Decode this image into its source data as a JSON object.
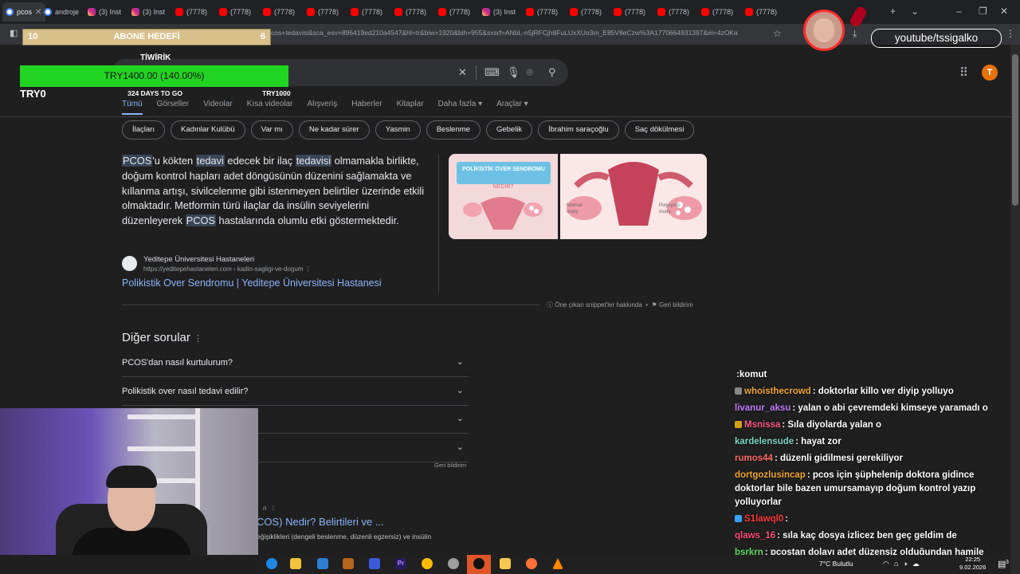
{
  "browser": {
    "tabs": [
      {
        "label": "pcos",
        "icon": "google-icon",
        "active": true
      },
      {
        "label": "androje",
        "icon": "google-icon"
      },
      {
        "label": "(3) Inst",
        "icon": "instagram-icon"
      },
      {
        "label": "(3) Inst",
        "icon": "instagram-icon"
      },
      {
        "label": "(7778)",
        "icon": "youtube-icon"
      },
      {
        "label": "(7778)",
        "icon": "youtube-icon"
      },
      {
        "label": "(7778)",
        "icon": "youtube-icon"
      },
      {
        "label": "(7778)",
        "icon": "youtube-icon"
      },
      {
        "label": "(7778)",
        "icon": "youtube-icon"
      },
      {
        "label": "(7778)",
        "icon": "youtube-icon"
      },
      {
        "label": "(7778)",
        "icon": "youtube-icon"
      },
      {
        "label": "(3) Inst",
        "icon": "instagram-icon"
      },
      {
        "label": "(7778)",
        "icon": "youtube-icon"
      },
      {
        "label": "(7778)",
        "icon": "youtube-icon"
      },
      {
        "label": "(7778)",
        "icon": "youtube-icon"
      },
      {
        "label": "(7778)",
        "icon": "youtube-icon"
      },
      {
        "label": "(7778)",
        "icon": "youtube-icon"
      },
      {
        "label": "(7778)",
        "icon": "youtube-icon"
      }
    ],
    "url": "cos+tedavisi&sca_esv=896419ed210a4547&hl=tr&biw=1920&bih=955&sxsrf=ANbL-n5jRFCjh8FuLUxXUo3m_E85V8eCzw%3A1770664931397&ei=4zOKa"
  },
  "search": {
    "nav_tabs": [
      "Tümü",
      "Görseller",
      "Videolar",
      "Kısa videolar",
      "Alışveriş",
      "Haberler",
      "Kitaplar",
      "Daha fazla ▾",
      "Araçlar ▾"
    ],
    "chips": [
      "İlaçları",
      "Kadınlar Kulübü",
      "Var mı",
      "Ne kadar sürer",
      "Yasmin",
      "Beslenme",
      "Gebelik",
      "İbrahim saraçoğlu",
      "Saç dökülmesi"
    ],
    "avatar_letter": "T"
  },
  "snippet": {
    "p1_hl": "PCOS",
    "p1": "'u kökten ",
    "p2_hl": "tedavi",
    "p2": " edecek bir ilaç ",
    "p3_hl": "tedavisi",
    "p3": " olmamakla birlikte, doğum kontrol hapları adet döngüsünün düzenini sağlamakta ve kıllanma artışı, sivilcelenme gibi istenmeyen belirtiler üzerinde etkili olmaktadır. Metformin türü ilaçlar da insülin seviyelerini düzenleyerek ",
    "p4_hl": "PCOS",
    "p4": " hastalarında olumlu etki göstermektedir.",
    "source_name": "Yeditepe Üniversitesi Hastaneleri",
    "source_url": "https://yeditepehastaneleri.com › kadin-sagligi-ve-dogum",
    "link": "Polikistik Over Sendromu | Yeditepe Üniversitesi Hastanesi",
    "about": "Öne çıkan snippet'ler hakkında",
    "feedback": "Geri bildirim",
    "image1_title": "POLİKİSTİK OVER SENDROMU",
    "image1_sub": "NEDİR?",
    "image2_l1": "Normal",
    "image2_l2": "ovary",
    "image2_r1": "Polycystic",
    "image2_r2": "ovary"
  },
  "paa": {
    "title": "Diğer sorular",
    "questions": [
      "PCOS'dan nasıl kurtulurum?",
      "Polikistik over nasıl tedavi edilir?",
      "",
      ""
    ],
    "feedback": "Geri bildirim"
  },
  "result2": {
    "title": "COS) Nedir? Belirtileri ve ...",
    "desc": "eğişiklikleri (dengeli beslenme, düzenli egzersiz) ve insülin",
    "crumb": "n"
  },
  "overlay": {
    "goal1_left": "10",
    "goal1_label": "ABONE HEDEFİ",
    "goal1_right": "6",
    "goal1_progress": 1.0,
    "donation_title": "TİWİRİK",
    "goal2_label": "TRY1400.00 (140.00%)",
    "goal2_progress": 1.0,
    "days": "324 DAYS TO GO",
    "target": "TRY1000",
    "start": "TRY0",
    "yt_handle": "youtube/tssigalko"
  },
  "chat": [
    {
      "user": "",
      "text": ":komut",
      "color": "#ffffff"
    },
    {
      "user": "whoisthecrowd",
      "text": ": doktorlar killo ver diyip yolluyo",
      "color": "#f0a830",
      "badge": "#888888"
    },
    {
      "user": "livanur_aksu",
      "text": ": yalan o abi çevremdeki kimseye yaramadı o",
      "color": "#c77dff"
    },
    {
      "user": "Msnissa",
      "text": ": Sıla diyolarda yalan o",
      "color": "#ff5c8a",
      "badge": "#d4a017"
    },
    {
      "user": "kardelensude",
      "text": ": hayat zor",
      "color": "#7fd6c2"
    },
    {
      "user": "rumos44",
      "text": ": düzenli gidilmesi gerekiliyor",
      "color": "#ff6b6b"
    },
    {
      "user": "dortgozlusincap",
      "text": ": pcos için şüphelenip doktora gidince doktorlar bile bazen umursamayıp doğum kontrol yazıp yolluyorlar",
      "color": "#f0a830"
    },
    {
      "user": "S1lawql0",
      "text": ":",
      "color": "#ff3b3b",
      "badge": "#3aa0ff"
    },
    {
      "user": "qlaws_16",
      "text": ": sıla kaç dosya izlicez ben geç geldim de",
      "color": "#ff4f7b"
    },
    {
      "user": "bsrkrn",
      "text": ": pcostan dolayı adet düzensiz olduğundan hamile kalmak zorlasıyor",
      "color": "#5fe05f"
    }
  ],
  "taskbar": {
    "weather": "7°C  Bulutlu",
    "time": "22:25",
    "date": "9.02.2026",
    "notif": "3"
  }
}
